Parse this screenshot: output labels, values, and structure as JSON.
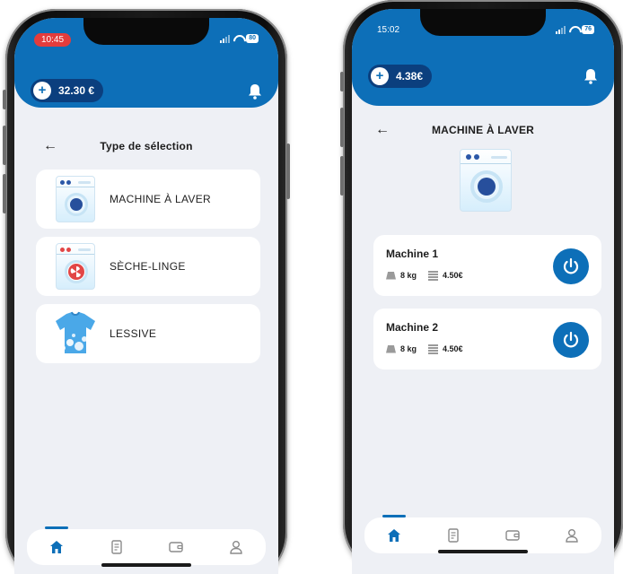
{
  "left_screen": {
    "status": {
      "time": "10:45",
      "battery": "80"
    },
    "balance": {
      "add_symbol": "+",
      "amount": "32.30 €"
    },
    "title": "Type de sélection",
    "options": [
      {
        "label": "MACHINE À LAVER",
        "icon": "washing-machine-icon"
      },
      {
        "label": "SÈCHE-LINGE",
        "icon": "dryer-icon"
      },
      {
        "label": "LESSIVE",
        "icon": "detergent-shirt-icon"
      }
    ]
  },
  "right_screen": {
    "status": {
      "time": "15:02",
      "battery": "76"
    },
    "balance": {
      "add_symbol": "+",
      "amount": "4.38€"
    },
    "title": "MACHINE À LAVER",
    "machines": [
      {
        "name": "Machine 1",
        "capacity": "8 kg",
        "price": "4.50€"
      },
      {
        "name": "Machine 2",
        "capacity": "8 kg",
        "price": "4.50€"
      }
    ]
  },
  "tabs": [
    "home-icon",
    "receipt-icon",
    "wallet-icon",
    "profile-icon"
  ],
  "colors": {
    "brand_blue": "#0d6fb8",
    "balance_pill": "#0b3f7e",
    "background": "#eef0f5"
  }
}
